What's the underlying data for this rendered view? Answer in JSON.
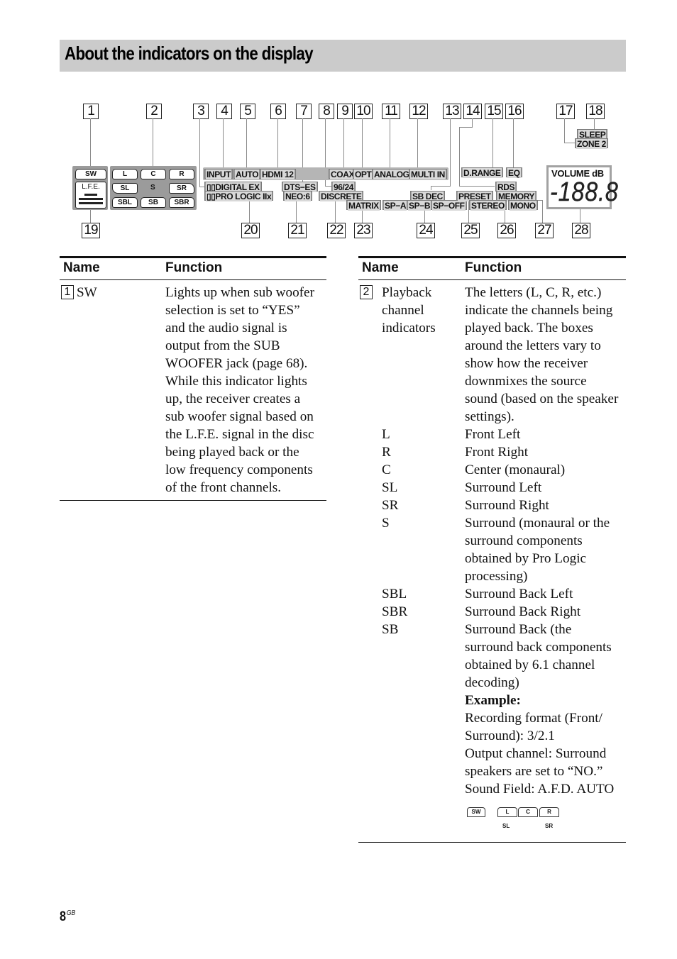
{
  "section": {
    "title": "About the indicators on the display"
  },
  "display": {
    "callouts": [
      "1",
      "2",
      "3",
      "4",
      "5",
      "6",
      "7",
      "8",
      "9",
      "10",
      "11",
      "12",
      "13",
      "14",
      "15",
      "16",
      "17",
      "18",
      "19",
      "20",
      "21",
      "22",
      "23",
      "24",
      "25",
      "26",
      "27",
      "28"
    ],
    "indicators": {
      "sw": "SW",
      "lfe": "L.F.E.",
      "channels": {
        "l": "L",
        "c": "C",
        "r": "R",
        "sl": "SL",
        "s": "S",
        "sr": "SR",
        "sbl": "SBL",
        "sb": "SB",
        "sbr": "SBR"
      },
      "input": "INPUT",
      "auto": "AUTO",
      "hdmi": "HDMI 12",
      "coax": "COAX",
      "opt": "OPT",
      "analog": "ANALOG",
      "multi_in": "MULTI IN",
      "digital_ex": "▯▯DIGITAL EX",
      "pro_logic": "▯▯PRO LOGIC IIx",
      "dts_es": "DTS−ES",
      "neo6": "NEO:6",
      "rate_96_24": "96/24",
      "discrete": "DISCRETE",
      "matrix": "MATRIX",
      "sb_dec": "SB DEC",
      "sp_a": "SP−A",
      "sp_b": "SP−B",
      "sp_off": "SP−OFF",
      "d_range": "D.RANGE",
      "eq": "EQ",
      "rds": "RDS",
      "preset": "PRESET",
      "memory": "MEMORY",
      "stereo": "STEREO",
      "mono": "MONO",
      "sleep": "SLEEP",
      "zone2": "ZONE 2",
      "volume_label": "VOLUME dB",
      "volume_value": "-188.8"
    }
  },
  "left_table": {
    "headers": {
      "name": "Name",
      "function": "Function"
    },
    "rows": [
      {
        "num": "1",
        "name": "SW",
        "function_lines": [
          "Lights up when sub woofer",
          "selection is set to “YES”",
          "and the audio signal is",
          "output from the SUB",
          "WOOFER jack (page 68).",
          "While this indicator lights",
          "up, the receiver creates a",
          "sub woofer signal based on",
          "the L.F.E. signal in the disc",
          "being played back or the",
          "low frequency components",
          "of the front channels."
        ]
      }
    ]
  },
  "right_table": {
    "headers": {
      "name": "Name",
      "function": "Function"
    },
    "row": {
      "num": "2",
      "name_lines": [
        "Playback",
        "channel",
        "indicators"
      ],
      "function_lines": [
        "The letters (L, C, R, etc.)",
        "indicate the channels being",
        "played back. The boxes",
        "around the letters vary to",
        "show how the receiver",
        "downmixes the source",
        "sound (based on the speaker",
        "settings)."
      ],
      "channels": [
        {
          "name": "L",
          "lines": [
            "Front Left"
          ]
        },
        {
          "name": "R",
          "lines": [
            "Front Right"
          ]
        },
        {
          "name": "C",
          "lines": [
            "Center (monaural)"
          ]
        },
        {
          "name": "SL",
          "lines": [
            "Surround Left"
          ]
        },
        {
          "name": "SR",
          "lines": [
            "Surround Right"
          ]
        },
        {
          "name": "S",
          "lines": [
            "Surround (monaural or the",
            "surround components",
            "obtained by Pro Logic",
            "processing)"
          ]
        },
        {
          "name": "SBL",
          "lines": [
            "Surround Back Left"
          ]
        },
        {
          "name": "SBR",
          "lines": [
            "Surround Back Right"
          ]
        },
        {
          "name": "SB",
          "lines": [
            "Surround Back (the",
            "surround back components",
            "obtained by 6.1 channel",
            "decoding)"
          ]
        }
      ],
      "example": {
        "heading": "Example:",
        "lines": [
          "Recording format (Front/",
          "Surround): 3/2.1",
          "Output channel: Surround",
          "speakers are set to “NO.”",
          "Sound Field: A.F.D. AUTO"
        ],
        "illustration": {
          "sw": "SW",
          "l": "L",
          "c": "C",
          "r": "R",
          "sl": "SL",
          "sr": "SR"
        }
      }
    }
  },
  "footer": {
    "page_number": "8",
    "page_suffix": "GB"
  }
}
